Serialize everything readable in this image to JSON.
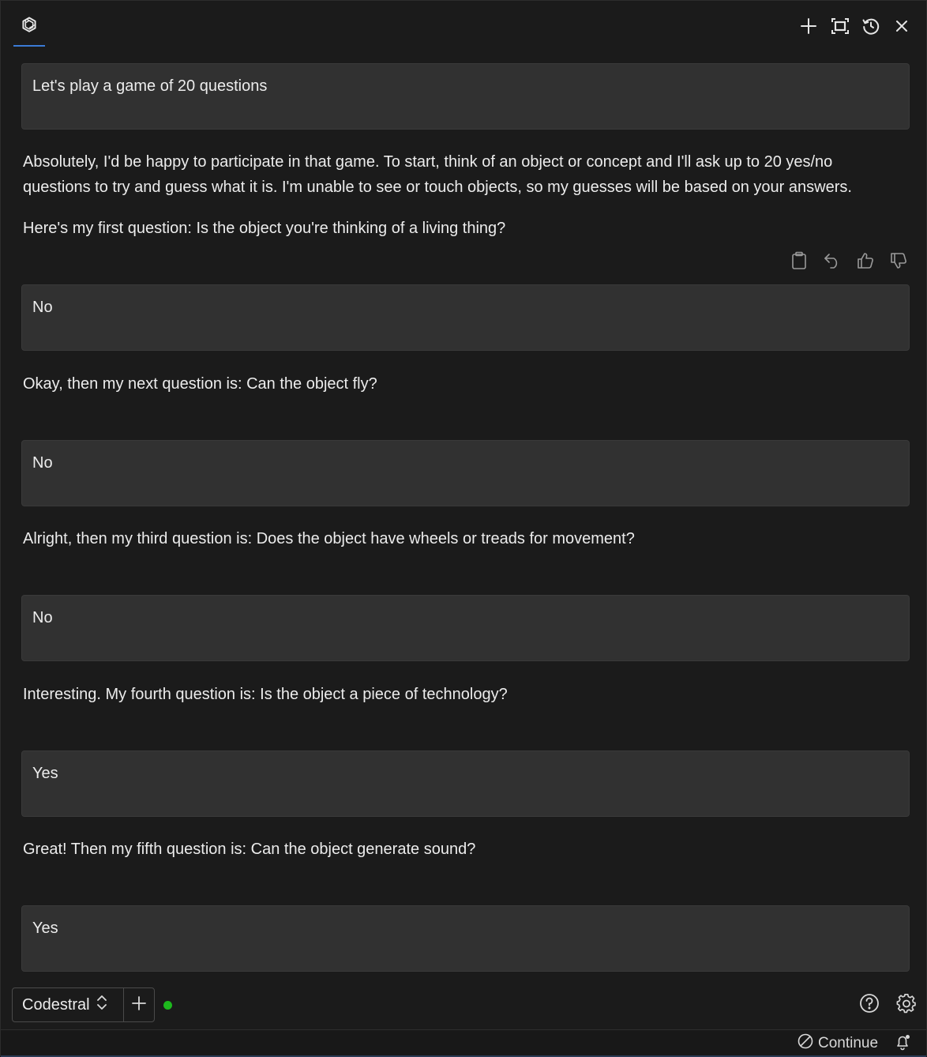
{
  "header": {
    "logo_icon": "openai-logo-icon",
    "actions": [
      "plus-icon",
      "fullscreen-icon",
      "history-icon",
      "close-icon"
    ]
  },
  "messages": [
    {
      "role": "user",
      "text": "Let's play a game of 20 questions"
    },
    {
      "role": "assistant",
      "paragraphs": [
        "Absolutely, I'd be happy to participate in that game. To start, think of an object or concept and I'll ask up to 20 yes/no questions to try and guess what it is. I'm unable to see or touch objects, so my guesses will be based on your answers.",
        "Here's my first question: Is the object you're thinking of a living thing?"
      ]
    },
    {
      "role": "user",
      "text": "No"
    },
    {
      "role": "assistant",
      "paragraphs": [
        "Okay, then my next question is: Can the object fly?"
      ]
    },
    {
      "role": "user",
      "text": "No"
    },
    {
      "role": "assistant",
      "paragraphs": [
        "Alright, then my third question is: Does the object have wheels or treads for movement?"
      ]
    },
    {
      "role": "user",
      "text": "No"
    },
    {
      "role": "assistant",
      "paragraphs": [
        "Interesting. My fourth question is: Is the object a piece of technology?"
      ]
    },
    {
      "role": "user",
      "text": "Yes"
    },
    {
      "role": "assistant",
      "paragraphs": [
        "Great! Then my fifth question is: Can the object generate sound?"
      ]
    },
    {
      "role": "user",
      "text": "Yes"
    }
  ],
  "message_actions": [
    "clipboard-icon",
    "undo-icon",
    "thumbs-up-icon",
    "thumbs-down-icon"
  ],
  "toolbar": {
    "model_label": "Codestral",
    "status_color": "#1db91d"
  },
  "statusbar": {
    "continue_label": "Continue"
  },
  "colors": {
    "background": "#1b1b1b",
    "user_bubble": "#313131",
    "accent": "#3b7bd6"
  }
}
